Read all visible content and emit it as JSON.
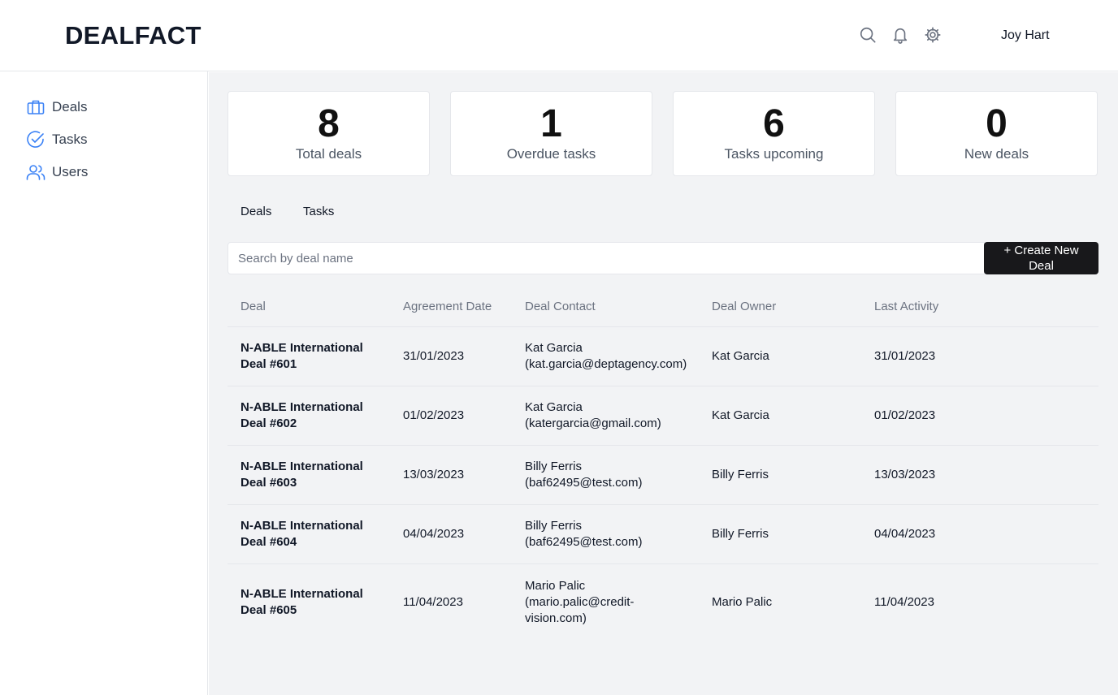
{
  "app": {
    "logo": "DEALFACT"
  },
  "header": {
    "user_name": "Joy Hart",
    "icons": [
      "search-icon",
      "bell-icon",
      "gear-icon"
    ]
  },
  "sidebar": {
    "items": [
      {
        "label": "Deals",
        "icon": "briefcase-icon"
      },
      {
        "label": "Tasks",
        "icon": "check-circle-icon"
      },
      {
        "label": "Users",
        "icon": "users-icon"
      }
    ]
  },
  "stats": [
    {
      "value": "8",
      "label": "Total deals"
    },
    {
      "value": "1",
      "label": "Overdue tasks"
    },
    {
      "value": "6",
      "label": "Tasks upcoming"
    },
    {
      "value": "0",
      "label": "New deals"
    }
  ],
  "tabs": [
    {
      "label": "Deals"
    },
    {
      "label": "Tasks"
    }
  ],
  "search": {
    "placeholder": "Search by deal name",
    "value": ""
  },
  "create_button": {
    "label": "+ Create New Deal"
  },
  "table": {
    "columns": [
      "Deal",
      "Agreement Date",
      "Deal Contact",
      "Deal Owner",
      "Last Activity"
    ],
    "rows": [
      {
        "deal": "N-ABLE International Deal #601",
        "agreement_date": "31/01/2023",
        "contact_name": "Kat Garcia",
        "contact_email": "(kat.garcia@deptagency.com)",
        "owner": "Kat Garcia",
        "last_activity": "31/01/2023"
      },
      {
        "deal": "N-ABLE International Deal #602",
        "agreement_date": "01/02/2023",
        "contact_name": "Kat Garcia",
        "contact_email": "(katergarcia@gmail.com)",
        "owner": "Kat Garcia",
        "last_activity": "01/02/2023"
      },
      {
        "deal": "N-ABLE International Deal #603",
        "agreement_date": "13/03/2023",
        "contact_name": "Billy Ferris",
        "contact_email": "(baf62495@test.com)",
        "owner": "Billy Ferris",
        "last_activity": "13/03/2023"
      },
      {
        "deal": "N-ABLE International Deal #604",
        "agreement_date": "04/04/2023",
        "contact_name": "Billy Ferris",
        "contact_email": "(baf62495@test.com)",
        "owner": "Billy Ferris",
        "last_activity": "04/04/2023"
      },
      {
        "deal": "N-ABLE International Deal #605",
        "agreement_date": "11/04/2023",
        "contact_name": "Mario Palic",
        "contact_email": "(mario.palic@credit-vision.com)",
        "owner": "Mario Palic",
        "last_activity": "11/04/2023"
      }
    ]
  },
  "colors": {
    "accent": "#3b82f6",
    "button_bg": "#18181b",
    "main_bg": "#f2f3f5"
  }
}
